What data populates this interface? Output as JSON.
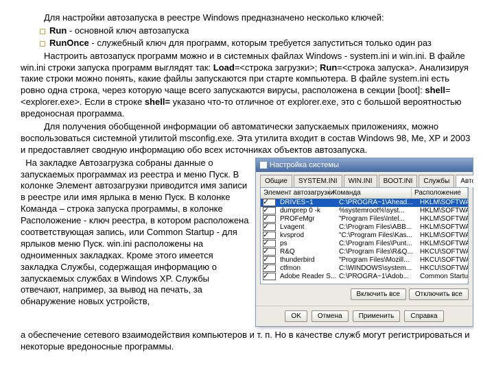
{
  "intro": "Для настройки автозапуска в реестре Windows предназначено несколько ключей:",
  "bullets": [
    {
      "key": "Run",
      "desc": " - основной ключ автозапуска"
    },
    {
      "key": "RunOnce",
      "desc": " - служебный ключ для программ, которым требуется запуститься только один раз"
    }
  ],
  "p2_a": "Настроить автозапуск программ можно и в системных файлах Windows - system.ini и win.ini. В файле win.ini строки запуска программ выглядят так: ",
  "p2_load": "Load",
  "p2_b": "=<строка загрузки>; ",
  "p2_run": "Run",
  "p2_c": "=<строка запуска>. Анализируя такие строки можно понять, какие файлы запускаются при старте компьютера. В файле system.ini есть ровно одна строка, через которую чаще всего запускаются вирусы, расположена в секции [boot]: ",
  "p2_shell": "shell",
  "p2_d": "=<explorer.exe>. Если в строке ",
  "p2_shell2": "shell=",
  "p2_e": " указано что-то отличное от explorer.exe, это с большой вероятностью вредоносная программа.",
  "p3": "Для получения обобщенной информации об автоматически запускаемых приложениях, можно воспользоваться системной утилитой msconfig.exe. Эта утилита входит в состав Windows 98, Me, XP и 2003 и предоставляет сводную информацию обо всех источниках объектов автозапуска.",
  "p4": "  На закладке Автозагрузка собраны данные о запускаемых программах из реестра и меню Пуск. В колонке Элемент автозагрузки приводится имя записи в реестре или имя ярлыка в меню Пуск. В колонке Команда – строка запуска программы, в колонке Расположение - ключ реестра, в котором расположена соответствующая запись, или Common Startup - для ярлыков меню Пуск. win.ini расположены на одноименных закладках. Кроме этого имеется закладка Службы, содержащая информацию о запускаемых службах в Windows XP. Службы отвечают, например, за вывод на печать, за обнаружение новых устройств,",
  "p5": "а обеспечение сетевого взаимодействия компьютеров и т. п. Но в качестве служб могут регистрироваться и некоторые вредоносные программы.",
  "dialog": {
    "title": "Настройка системы",
    "tabs": [
      "Общие",
      "SYSTEM.INI",
      "WIN.INI",
      "BOOT.INI",
      "Службы",
      "Автозагрузка"
    ],
    "headers": {
      "c1": "Элемент автозагрузки",
      "c2": "Команда",
      "c3": "Расположение"
    },
    "rows": [
      {
        "name": "DRIVES~1",
        "cmd": "C:\\PROGRA~1\\Ahead...",
        "loc": "HKLM\\SOFTWARE\\Microsoft\\Windows\\CurrentVer..."
      },
      {
        "name": "dumprep 0 -k",
        "cmd": "%systemroot%\\syst...",
        "loc": "HKLM\\SOFTWARE\\Microsoft\\Windows\\CurrentVer..."
      },
      {
        "name": "PROFeMgr",
        "cmd": "\"Program Files\\Intel...",
        "loc": "HKLM\\SOFTWARE\\Microsoft\\Windows\\CurrentVer..."
      },
      {
        "name": "Lvagent",
        "cmd": "C:\\Program Files\\ABB...",
        "loc": "HKLM\\SOFTWARE\\Microsoft\\Windows\\CurrentVer..."
      },
      {
        "name": "kvsprod",
        "cmd": "\"C:\\Program Files\\Kas...",
        "loc": "HKLM\\SOFTWARE\\Microsoft\\Windows\\CurrentVer..."
      },
      {
        "name": "ps",
        "cmd": "C:\\Program Files\\Punt...",
        "loc": "HKLM\\SOFTWARE\\Microsoft\\Windows\\CurrentVer..."
      },
      {
        "name": "R&Q",
        "cmd": "C:\\Program Files\\R&Q...",
        "loc": "HKCU\\SOFTWARE\\Microsoft\\Windows\\CurrentVer..."
      },
      {
        "name": "thunderbird",
        "cmd": "\"Program Files\\Mozill...",
        "loc": "HKCU\\SOFTWARE\\Microsoft\\Windows\\CurrentVer..."
      },
      {
        "name": "ctfmon",
        "cmd": "C:\\WINDOWS\\system...",
        "loc": "HKCU\\SOFTWARE\\Microsoft\\Windows\\CurrentVer..."
      },
      {
        "name": "Adobe Reader S...",
        "cmd": "C:\\PROGRA~1\\Adob...",
        "loc": "Common Startup"
      }
    ],
    "btn_enable": "Включить все",
    "btn_disable": "Отключить все",
    "btn_ok": "OK",
    "btn_cancel": "Отмена",
    "btn_apply": "Применить",
    "btn_help": "Справка"
  }
}
